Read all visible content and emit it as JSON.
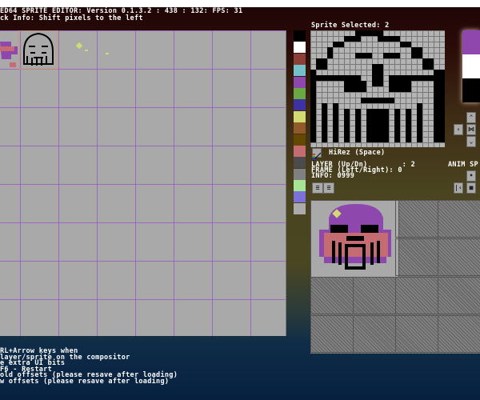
{
  "header": {
    "title": "ED64 SPRITE EDITOR: Version 0.1.3.2 : 438 : 132: FPS: 31",
    "info": "ck Info: Shift pixels to the left"
  },
  "sprite_panel": {
    "selected_label": "Sprite Selected: 2",
    "mode_label": "HiRez (Space)",
    "layer_line": "LAYER (Up/Dn)        : 2",
    "frame_line": "FRAME (Left/Right): 0",
    "info_line": "INFO: 0999",
    "anim_label": "ANIM SP"
  },
  "palette": [
    "#000000",
    "#ffffff",
    "#8b3f36",
    "#75c1c9",
    "#8d47ad",
    "#68a941",
    "#3e31a2",
    "#d0dc71",
    "#92592a",
    "#654800",
    "#c46c71",
    "#4b4b4b",
    "#808080",
    "#a6e594",
    "#7c70da",
    "#ababab"
  ],
  "preview_colors": [
    "#8d47ad",
    "#ffffff",
    "#000000"
  ],
  "help_lines": [
    "RL+Arrow keys when",
    "layer/sprite on the compositor",
    "e extra UI bits",
    "F6 - Restart",
    "old offsets (please resave after loading)",
    "w offsets (please resave after loading)"
  ]
}
